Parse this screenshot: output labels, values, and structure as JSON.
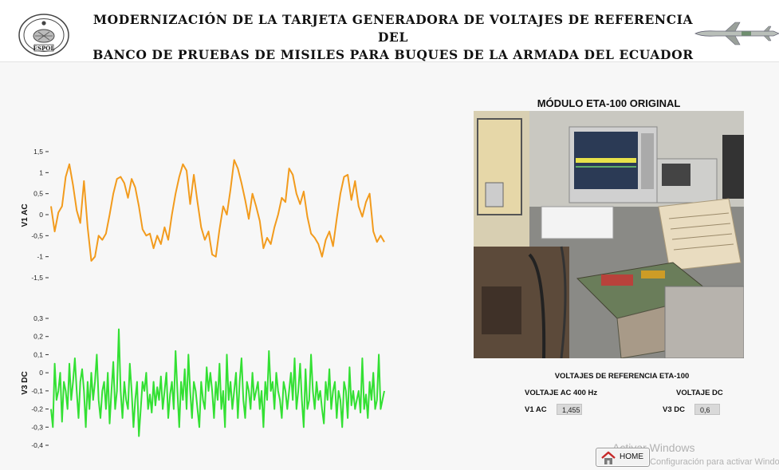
{
  "header": {
    "title_line1": "MODERNIZACIÓN DE LA TARJETA GENERADORA DE VOLTAJES DE REFERENCIA DEL",
    "title_line2": "BANCO DE PRUEBAS DE MISILES PARA BUQUES DE LA ARMADA DEL ECUADOR",
    "logo_text": "ESPOL"
  },
  "chart_data": [
    {
      "type": "line",
      "ylabel": "V1 AC",
      "ylim": [
        -1.5,
        1.5
      ],
      "yticks": [
        "1,5",
        "1",
        "0,5",
        "0",
        "-0,5",
        "-1",
        "-1,5"
      ],
      "color": "#f29b1d",
      "grid": false,
      "values": [
        0.2,
        -0.4,
        0.05,
        0.2,
        0.9,
        1.2,
        0.7,
        0.1,
        -0.2,
        0.8,
        -0.3,
        -1.1,
        -1.0,
        -0.5,
        -0.6,
        -0.45,
        0.0,
        0.5,
        0.85,
        0.9,
        0.75,
        0.4,
        0.85,
        0.65,
        0.2,
        -0.35,
        -0.5,
        -0.45,
        -0.8,
        -0.5,
        -0.7,
        -0.3,
        -0.6,
        0.0,
        0.5,
        0.9,
        1.2,
        1.05,
        0.25,
        0.95,
        0.3,
        -0.3,
        -0.6,
        -0.4,
        -0.95,
        -1.0,
        -0.35,
        0.2,
        0.0,
        0.6,
        1.3,
        1.1,
        0.75,
        0.35,
        -0.1,
        0.5,
        0.2,
        -0.15,
        -0.8,
        -0.55,
        -0.7,
        -0.3,
        0.0,
        0.4,
        0.3,
        1.1,
        0.95,
        0.5,
        0.25,
        0.55,
        -0.05,
        -0.45,
        -0.55,
        -0.7,
        -1.0,
        -0.6,
        -0.4,
        -0.75,
        -0.1,
        0.5,
        0.9,
        0.95,
        0.35,
        0.8,
        0.2,
        -0.05,
        0.3,
        0.5,
        -0.4,
        -0.65,
        -0.5,
        -0.65
      ]
    },
    {
      "type": "line",
      "ylabel": "V3 DC",
      "ylim": [
        -0.4,
        0.3
      ],
      "yticks": [
        "0,3",
        "0,2",
        "0,1",
        "0",
        "-0,1",
        "-0,2",
        "-0,3",
        "-0,4"
      ],
      "color": "#33e033",
      "grid": false,
      "values": [
        -0.2,
        -0.3,
        0.05,
        -0.15,
        -0.1,
        0.0,
        -0.27,
        -0.05,
        -0.1,
        -0.2,
        0.05,
        -0.15,
        -0.05,
        0.08,
        -0.1,
        -0.25,
        -0.05,
        0.02,
        -0.1,
        -0.3,
        -0.05,
        -0.2,
        0.0,
        -0.15,
        -0.05,
        0.1,
        -0.15,
        -0.25,
        -0.1,
        -0.05,
        -0.2,
        0.0,
        -0.28,
        -0.1,
        0.06,
        -0.2,
        -0.1,
        0.24,
        -0.1,
        -0.25,
        -0.05,
        -0.15,
        -0.2,
        0.05,
        -0.1,
        -0.3,
        -0.15,
        -0.05,
        -0.35,
        -0.2,
        -0.05,
        -0.1,
        0.0,
        -0.2,
        -0.12,
        -0.22,
        -0.05,
        -0.18,
        -0.08,
        -0.15,
        -0.02,
        -0.2,
        -0.1,
        0.0,
        -0.25,
        -0.12,
        -0.05,
        -0.2,
        0.12,
        -0.1,
        -0.3,
        -0.05,
        -0.15,
        0.02,
        -0.2,
        0.1,
        -0.1,
        -0.25,
        -0.05,
        -0.1,
        -0.2,
        -0.3,
        -0.05,
        -0.15,
        -0.2,
        0.03,
        -0.1,
        0.0,
        -0.1,
        -0.25,
        -0.05,
        -0.15,
        0.05,
        -0.2,
        -0.1,
        -0.3,
        0.1,
        -0.15,
        -0.05,
        -0.2,
        -0.1,
        0.0,
        -0.25,
        -0.05,
        0.08,
        -0.15,
        -0.25,
        -0.05,
        -0.1,
        -0.2,
        0.0,
        -0.15,
        -0.1,
        -0.05,
        -0.2,
        -0.1,
        -0.3,
        -0.05,
        -0.15,
        0.12,
        -0.1,
        -0.05,
        -0.2,
        0.0,
        -0.1,
        -0.15,
        -0.25,
        -0.05,
        -0.1,
        -0.2,
        -0.1,
        0.0,
        -0.15,
        0.08,
        -0.2,
        -0.1,
        0.05,
        -0.15,
        -0.3,
        0.02,
        -0.2,
        -0.15,
        0.1,
        -0.1,
        -0.2,
        -0.05,
        -0.15,
        -0.1,
        -0.2,
        -0.28,
        -0.05,
        -0.15,
        0.02,
        -0.2,
        -0.1,
        -0.05,
        -0.25,
        -0.1,
        -0.15,
        -0.3,
        -0.05,
        -0.1,
        -0.25,
        0.03,
        -0.18,
        -0.1,
        -0.2,
        -0.15,
        -0.1,
        -0.22,
        0.08,
        -0.2,
        -0.12,
        -0.25,
        -0.05,
        -0.15,
        0.0,
        -0.2,
        -0.15,
        0.1,
        -0.2,
        -0.15,
        -0.1
      ]
    }
  ],
  "photo": {
    "title": "MÓDULO ETA-100 ORIGINAL"
  },
  "reference_panel": {
    "title": "VOLTAJES DE REFERENCIA ETA-100",
    "ac_label": "VOLTAJE AC 400 Hz",
    "dc_label": "VOLTAJE DC",
    "v1_label": "V1 AC",
    "v1_value": "1,455",
    "v3_label": "V3 DC",
    "v3_value": "0,6"
  },
  "home_button": {
    "label": "HOME"
  },
  "watermark": {
    "line1": "Activar Windows",
    "line2": "Ve a Configuración para activar Windows."
  }
}
